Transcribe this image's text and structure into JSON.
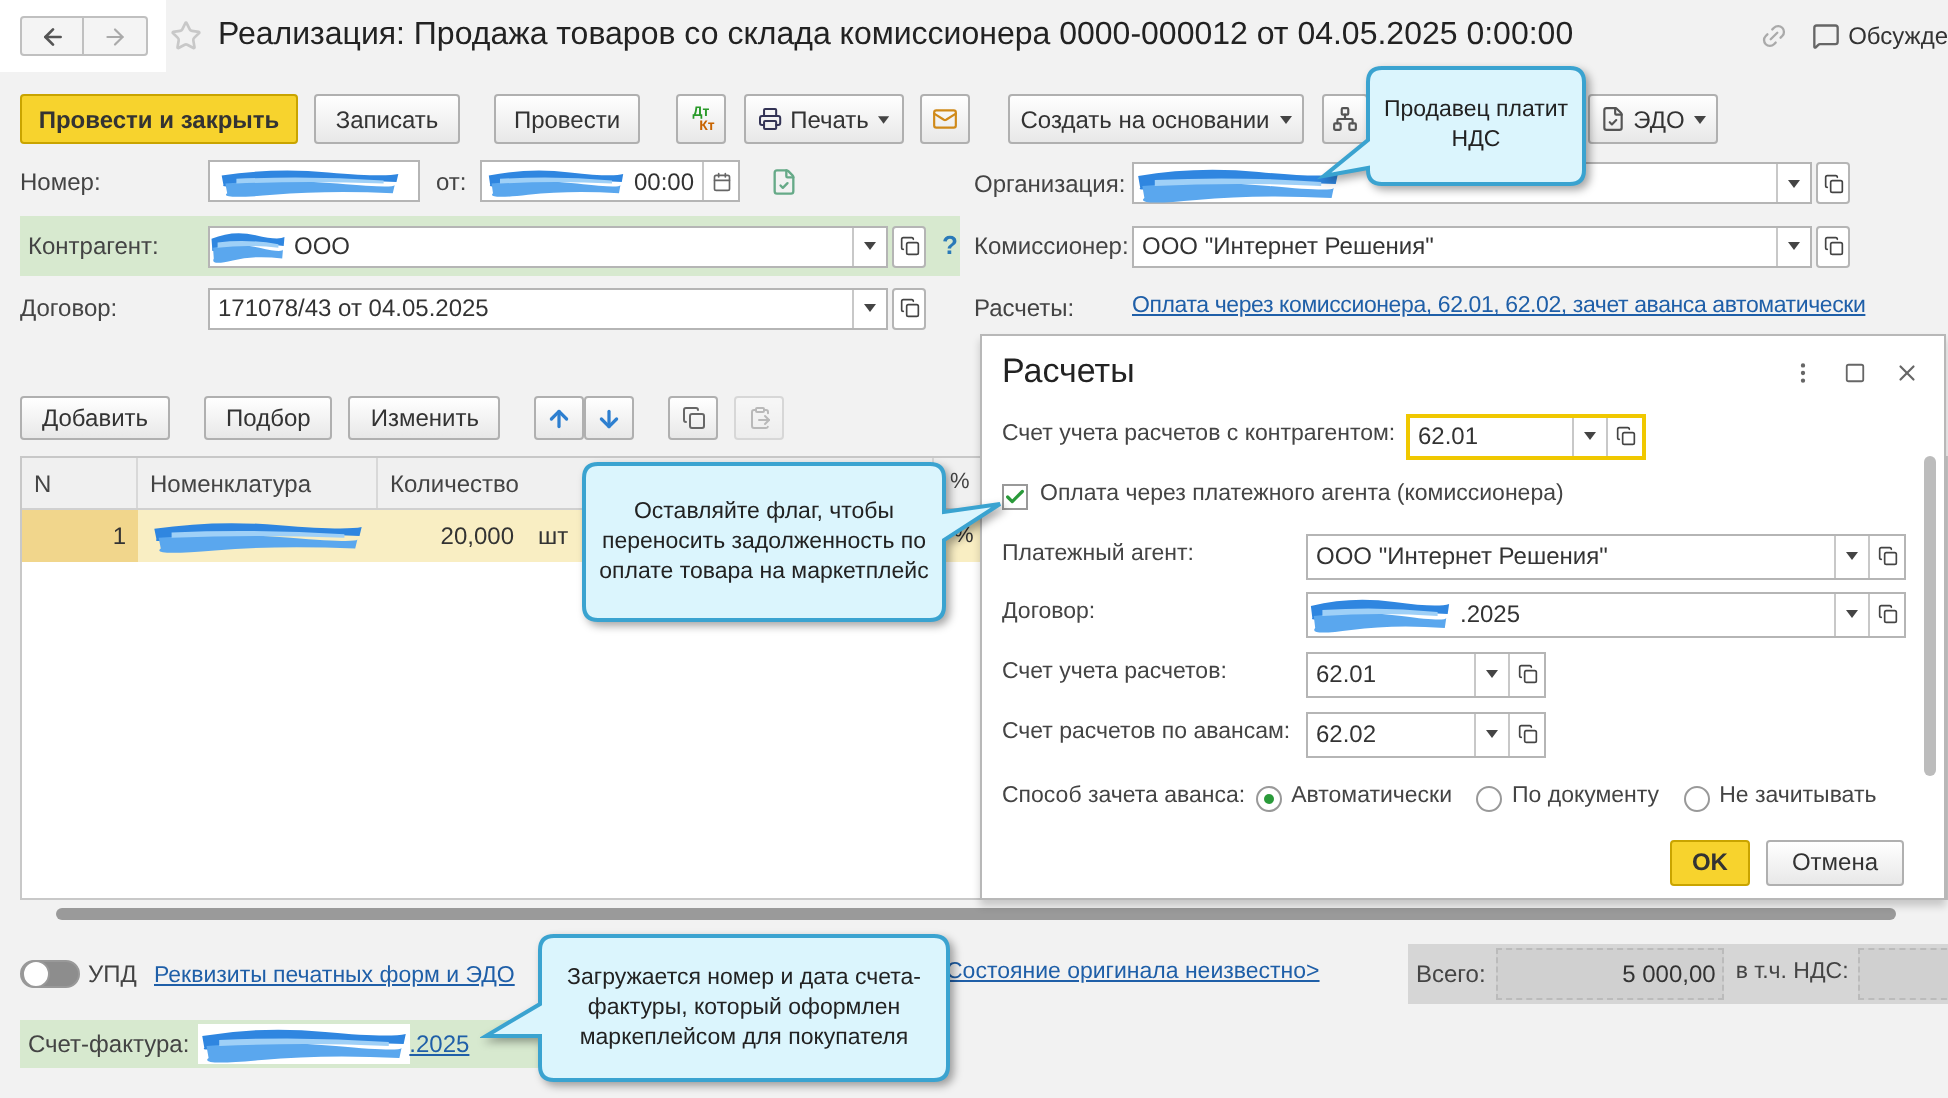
{
  "header": {
    "title": "Реализация: Продажа товаров со склада комиссионера 0000-000012 от 04.05.2025 0:00:00",
    "discuss": "Обсужде"
  },
  "toolbar": [
    {
      "kind": "primary",
      "label": "Провести и закрыть"
    },
    {
      "kind": "button",
      "label": "Записать"
    },
    {
      "kind": "button",
      "label": "Провести"
    },
    {
      "kind": "dtkt",
      "top": "Дт",
      "bottom": "Кт"
    },
    {
      "kind": "print",
      "label": "Печать"
    },
    {
      "kind": "mail"
    },
    {
      "kind": "menu",
      "label": "Создать на основании"
    },
    {
      "kind": "structure"
    },
    {
      "kind": "edo",
      "label": "ЭДО"
    }
  ],
  "fields_left": [
    {
      "kind": "number",
      "label": "Номер:",
      "redacted": true,
      "date_label": "от:",
      "time": "00:00"
    },
    {
      "kind": "ref",
      "label": "Контрагент:",
      "redacted": true,
      "value": "ООО",
      "highlighted": true,
      "help": "?"
    },
    {
      "kind": "ref",
      "label": "Договор:",
      "redacted": false,
      "value": "171078/43 от 04.05.2025",
      "highlighted": false
    }
  ],
  "fields_right": [
    {
      "kind": "ref",
      "label": "Организация:",
      "redacted": true
    },
    {
      "kind": "ref",
      "label": "Комиссионер:",
      "redacted": false,
      "value": "ООО \"Интернет Решения\""
    },
    {
      "kind": "link",
      "label": "Расчеты:",
      "value": "Оплата через комиссионера, 62.01, 62.02, зачет аванса автоматически"
    }
  ],
  "table_toolbar": [
    {
      "kind": "text",
      "label": "Добавить"
    },
    {
      "kind": "text",
      "label": "Подбор"
    },
    {
      "kind": "text",
      "label": "Изменить"
    },
    {
      "kind": "up"
    },
    {
      "kind": "down"
    },
    {
      "kind": "copy",
      "disabled": false
    },
    {
      "kind": "paste",
      "disabled": true
    }
  ],
  "table": {
    "columns": [
      "N",
      "Номенклатура",
      "Количество",
      "",
      "%"
    ],
    "rows": [
      {
        "selected": true,
        "cells": [
          {
            "text": "1"
          },
          {
            "redacted": true
          },
          {
            "text": "20,000"
          },
          {
            "text": "шт"
          },
          {
            "text": "%"
          }
        ]
      }
    ]
  },
  "bottom": {
    "upd": {
      "label": "УПД",
      "on": false
    },
    "links": [
      "Реквизиты печатных форм и ЭДО",
      "Состояние оригинала неизвестно>"
    ],
    "total_label": "Всего:",
    "total": "5 000,00",
    "vat_label": "в т.ч. НДС:"
  },
  "invoice": {
    "label": "Счет-фактура:",
    "redacted": true,
    "value": ".2025"
  },
  "dialog": {
    "title": "Расчеты",
    "rows": [
      {
        "kind": "account",
        "label": "Счет учета расчетов с контрагентом:",
        "value": "62.01",
        "focused": true
      },
      {
        "kind": "checkbox",
        "label": "Оплата через платежного агента (комиссионера)",
        "checked": true
      },
      {
        "kind": "ref",
        "label": "Платежный агент:",
        "value": "ООО \"Интернет Решения\"",
        "redacted": false
      },
      {
        "kind": "ref",
        "label": "Договор:",
        "value": ".2025",
        "redacted": true
      },
      {
        "kind": "account",
        "label": "Счет учета расчетов:",
        "value": "62.01",
        "focused": false
      },
      {
        "kind": "account",
        "label": "Счет расчетов по авансам:",
        "value": "62.02",
        "focused": false
      },
      {
        "kind": "radio",
        "label": "Способ зачета аванса:",
        "options": [
          {
            "label": "Автоматически",
            "selected": true
          },
          {
            "label": "По документу",
            "selected": false
          },
          {
            "label": "Не зачитывать",
            "selected": false
          }
        ]
      }
    ],
    "buttons": [
      {
        "kind": "primary",
        "label": "OK"
      },
      {
        "kind": "default",
        "label": "Отмена"
      }
    ]
  },
  "callouts": [
    "Продавец платит НДС",
    "Оставляйте флаг, чтобы переносить задолженность по оплате товара на маркетплейс",
    "Загружается номер и дата счета-фактуры, который оформлен маркеплейсом для покупателя"
  ]
}
